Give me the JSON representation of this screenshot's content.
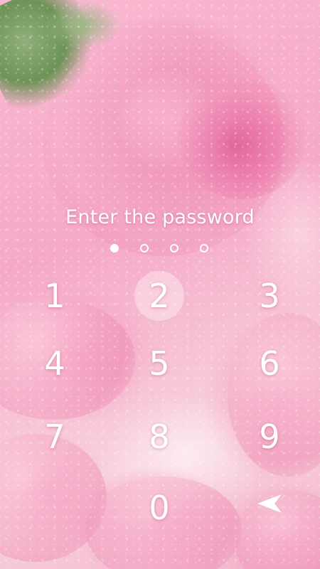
{
  "prompt": "Enter the password",
  "pin": {
    "length": 4,
    "entered": 1
  },
  "keypad": {
    "keys": [
      "1",
      "2",
      "3",
      "4",
      "5",
      "6",
      "7",
      "8",
      "9",
      "0"
    ],
    "pressed_key": "2",
    "backspace_icon": "back-arrow-icon"
  },
  "colors": {
    "text": "#ffffff",
    "background": "#f5a9c7"
  }
}
